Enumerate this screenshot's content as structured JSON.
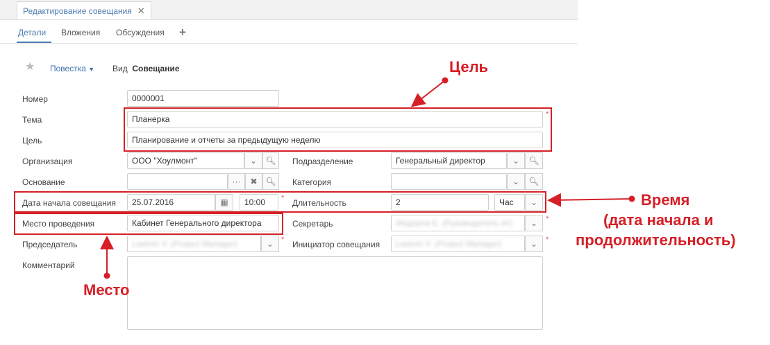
{
  "tab": {
    "title": "Редактирование совещания"
  },
  "subtabs": [
    "Детали",
    "Вложения",
    "Обсуждения"
  ],
  "toolbar": {
    "agenda": "Повестка",
    "view_label": "Вид",
    "view_value": "Совещание"
  },
  "fields": {
    "number": {
      "label": "Номер",
      "value": "0000001"
    },
    "subject": {
      "label": "Тема",
      "value": "Планерка"
    },
    "goal": {
      "label": "Цель",
      "value": "Планирование и отчеты за предыдущую неделю"
    },
    "organization": {
      "label": "Организация",
      "value": "ООО \"Хоулмонт\""
    },
    "department": {
      "label": "Подразделение",
      "value": "Генеральный директор"
    },
    "basis": {
      "label": "Основание",
      "value": ""
    },
    "category": {
      "label": "Категория",
      "value": ""
    },
    "start": {
      "label": "Дата начала совещания",
      "date": "25.07.2016",
      "time": "10:00"
    },
    "duration": {
      "label": "Длительность",
      "value": "2",
      "unit": "Час"
    },
    "place": {
      "label": "Место проведения",
      "value": "Кабинет Генерального директора"
    },
    "secretary": {
      "label": "Секретарь",
      "value": "Фёдоров Е. (Руководитель ит)"
    },
    "chair": {
      "label": "Председатель",
      "value": "Lastnm V. (Project Manager)"
    },
    "initiator": {
      "label": "Инициатор совещания",
      "value": "Lastnm V. (Project Manager)"
    },
    "comment": {
      "label": "Комментарий",
      "value": ""
    }
  },
  "annotations": {
    "goal": "Цель",
    "time_l1": "Время",
    "time_l2": "(дата начала и",
    "time_l3": "продолжительность)",
    "place": "Место"
  },
  "colors": {
    "accent": "#4a7ab0",
    "annotation": "#d61f26"
  }
}
